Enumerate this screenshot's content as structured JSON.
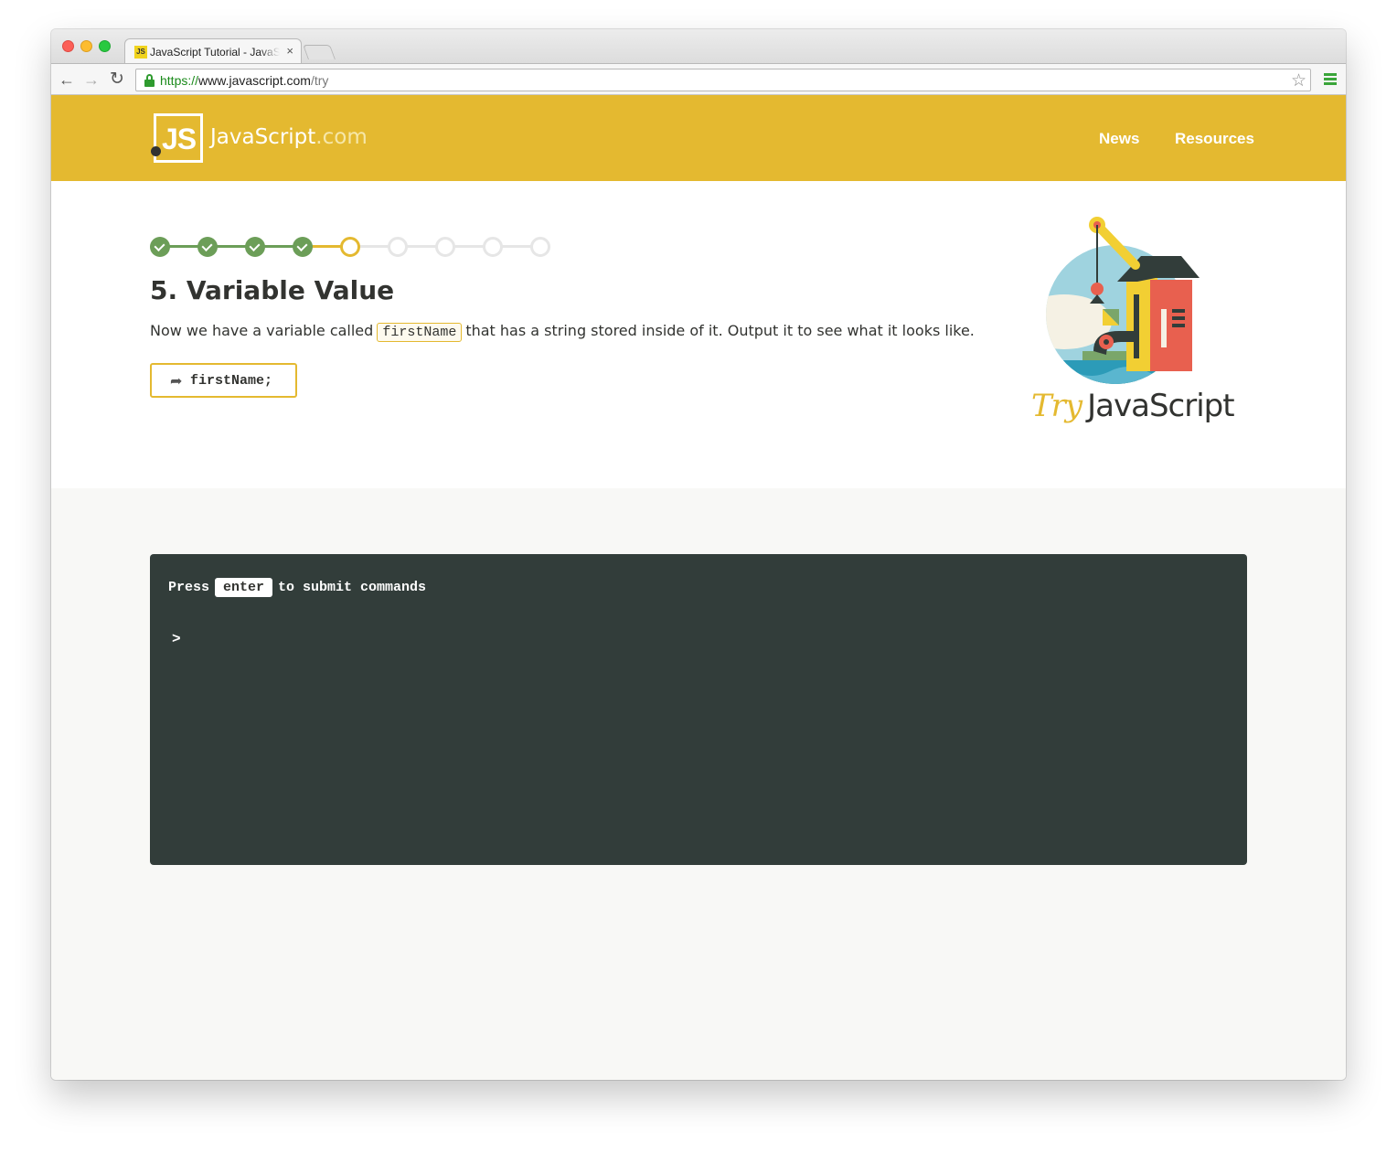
{
  "browser": {
    "tab_title": "JavaScript Tutorial - JavaScript.com",
    "tab_favicon_text": "JS",
    "tab_close": "×",
    "url_scheme": "https://",
    "url_host": "www.javascript.com",
    "url_path": "/try"
  },
  "header": {
    "logo_mark": "JS",
    "logo_name": "JavaScript",
    "logo_suffix": ".com",
    "nav": [
      "News",
      "Resources"
    ],
    "background_color": "#e4b930"
  },
  "lesson": {
    "progress": {
      "total_steps": 9,
      "completed_steps": 4,
      "current_step": 5
    },
    "title": "5. Variable Value",
    "text_before": "Now we have a variable called",
    "code_inline": "firstName",
    "text_after": "that has a string stored inside of it. Output it to see what it looks like.",
    "command_button": "firstName;"
  },
  "brand": {
    "try_word": "Try",
    "name": "JavaScript"
  },
  "console": {
    "hint_before": "Press",
    "hint_key": "enter",
    "hint_after": "to submit commands",
    "prompt": ">",
    "input_value": ""
  },
  "colors": {
    "accent": "#e4b930",
    "done": "#6c9e58",
    "console_bg": "#323d3a",
    "text": "#323330"
  }
}
